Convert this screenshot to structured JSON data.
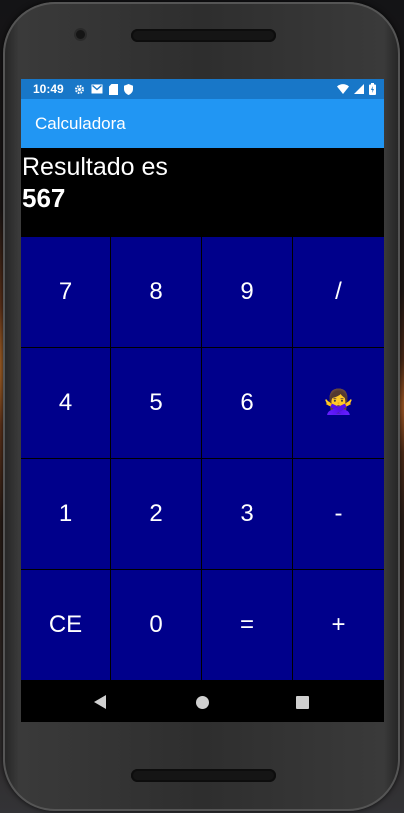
{
  "status_bar": {
    "time": "10:49",
    "left_icons": [
      "gear-icon",
      "gmail-icon",
      "sd-card-icon",
      "shield-icon"
    ],
    "right_icons": [
      "wifi-icon",
      "cell-signal-icon",
      "battery-icon"
    ]
  },
  "app_bar": {
    "title": "Calculadora"
  },
  "result": {
    "label": "Resultado es",
    "value": "567"
  },
  "keypad": {
    "keys": [
      {
        "label": "7"
      },
      {
        "label": "8"
      },
      {
        "label": "9"
      },
      {
        "label": "/"
      },
      {
        "label": "4"
      },
      {
        "label": "5"
      },
      {
        "label": "6"
      },
      {
        "label": "🙅‍♀️",
        "icon": "woman-gesturing-no-icon"
      },
      {
        "label": "1"
      },
      {
        "label": "2"
      },
      {
        "label": "3"
      },
      {
        "label": "-"
      },
      {
        "label": "CE"
      },
      {
        "label": "0"
      },
      {
        "label": "="
      },
      {
        "label": "+"
      }
    ]
  },
  "nav_bar": {
    "icons": [
      "back-icon",
      "home-icon",
      "recents-icon"
    ]
  },
  "colors": {
    "status_bar": "#1877c8",
    "app_bar": "#2196f3",
    "key_background": "#00008b",
    "screen_background": "#000000"
  }
}
